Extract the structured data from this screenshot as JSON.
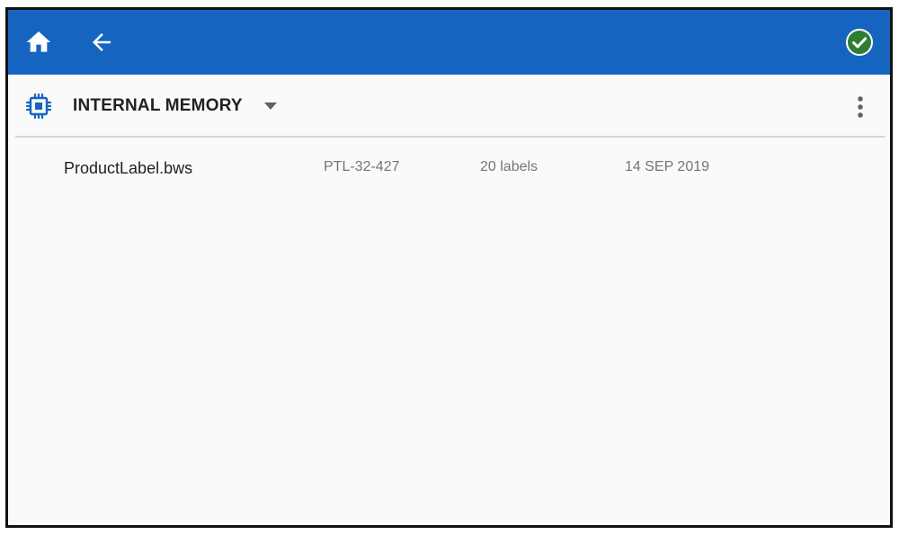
{
  "colors": {
    "toolbar": "#1565c0",
    "background": "#fafafa",
    "accent_icon": "#1565c0",
    "ok_check": "#2e7d32",
    "divider": "#d6d6d6"
  },
  "toolbar": {
    "home_icon": "home-icon",
    "back_icon": "arrow-back-icon",
    "confirm_icon": "check-circle-icon"
  },
  "storage": {
    "icon": "memory-chip-icon",
    "label": "INTERNAL MEMORY",
    "dropdown_icon": "dropdown-triangle-icon",
    "menu_icon": "more-vert-icon"
  },
  "files": [
    {
      "name": "ProductLabel.bws",
      "id": "PTL-32-427",
      "count": "20 labels",
      "date": "14 SEP 2019"
    }
  ]
}
